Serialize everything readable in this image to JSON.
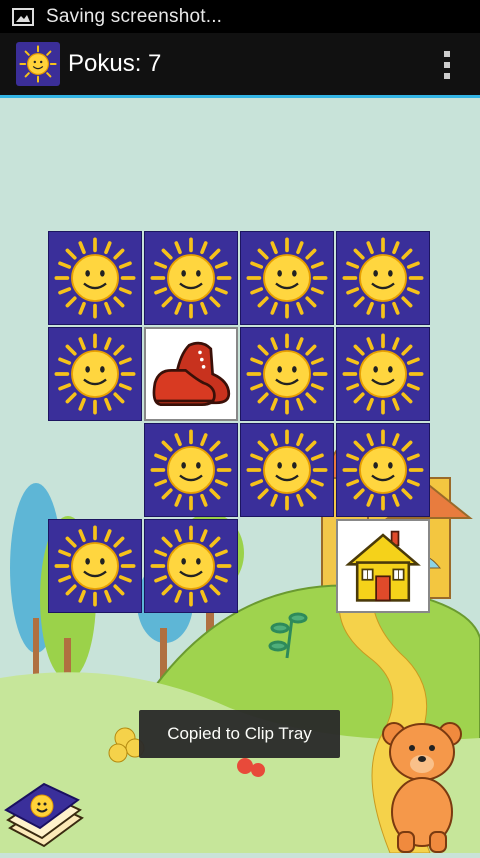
{
  "status_bar": {
    "notification_icon": "image-icon",
    "text": "Saving screenshot..."
  },
  "action_bar": {
    "app_icon": "sun-icon",
    "title": "Pokus: 7",
    "overflow_icon": "overflow-menu-icon"
  },
  "board": {
    "cards": [
      {
        "state": "hidden",
        "icon": "sun-icon"
      },
      {
        "state": "hidden",
        "icon": "sun-icon"
      },
      {
        "state": "hidden",
        "icon": "sun-icon"
      },
      {
        "state": "hidden",
        "icon": "sun-icon"
      },
      {
        "state": "hidden",
        "icon": "sun-icon"
      },
      {
        "state": "open",
        "icon": "boot-icon"
      },
      {
        "state": "hidden",
        "icon": "sun-icon"
      },
      {
        "state": "hidden",
        "icon": "sun-icon"
      },
      {
        "state": "empty"
      },
      {
        "state": "hidden",
        "icon": "sun-icon"
      },
      {
        "state": "hidden",
        "icon": "sun-icon"
      },
      {
        "state": "hidden",
        "icon": "sun-icon"
      },
      {
        "state": "hidden",
        "icon": "sun-icon"
      },
      {
        "state": "hidden",
        "icon": "sun-icon"
      },
      {
        "state": "empty"
      },
      {
        "state": "open",
        "icon": "house-icon"
      }
    ]
  },
  "toast": {
    "text": "Copied to Clip Tray"
  },
  "colors": {
    "card_back": "#3a2f9a",
    "accent": "#33b5e5"
  }
}
